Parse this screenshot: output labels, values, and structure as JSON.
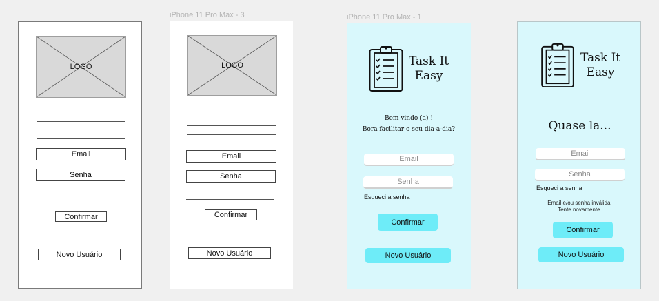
{
  "frames": {
    "f1": {
      "logo": "LOGO",
      "email": "Email",
      "password": "Senha",
      "confirm": "Confirmar",
      "new_user": "Novo Usuário"
    },
    "f2": {
      "label": "iPhone 11 Pro Max - 3",
      "logo": "LOGO",
      "email": "Email",
      "password": "Senha",
      "confirm": "Confirmar",
      "new_user": "Novo Usuário"
    },
    "f3": {
      "label": "iPhone 11 Pro Max - 1",
      "brand_line1": "Task It",
      "brand_line2": "Easy",
      "welcome_line1": "Bem vindo (a) !",
      "welcome_line2": "Bora facilitar o seu dia-a-dia?",
      "email_placeholder": "Email",
      "password_placeholder": "Senha",
      "forgot": "Esqueci a senha",
      "confirm": "Confirmar",
      "new_user": "Novo Usuário"
    },
    "f4": {
      "brand_line1": "Task It",
      "brand_line2": "Easy",
      "heading": "Quase la...",
      "email_placeholder": "Email",
      "password_placeholder": "Senha",
      "forgot": "Esqueci a senha",
      "error_line1": "Email e/ou senha inválida.",
      "error_line2": "Tente novamente.",
      "confirm": "Confirmar",
      "new_user": "Novo Usuário"
    }
  },
  "colors": {
    "canvas": "#f0f0f0",
    "teal_bg": "#d9f8fc",
    "accent": "#6eecf8",
    "wire_logo": "#d9d9d9"
  },
  "icons": {
    "brand": "clipboard-checklist-icon",
    "placeholder": "image-placeholder-icon"
  }
}
